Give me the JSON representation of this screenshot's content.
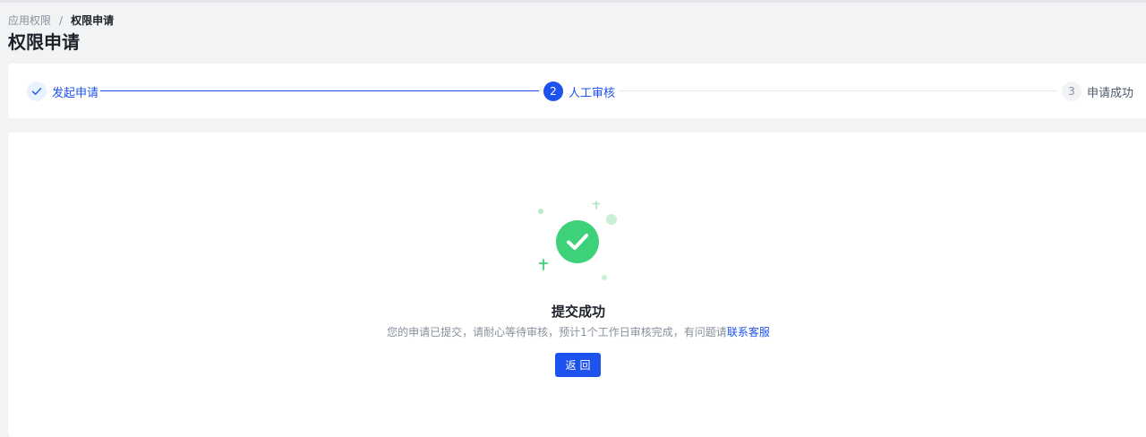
{
  "breadcrumb": {
    "items": [
      "应用权限",
      "权限申请"
    ],
    "separator": "/"
  },
  "page": {
    "title": "权限申请"
  },
  "steps": [
    {
      "number": "1",
      "label": "发起申请",
      "status": "done"
    },
    {
      "number": "2",
      "label": "人工审核",
      "status": "active"
    },
    {
      "number": "3",
      "label": "申请成功",
      "status": "pending"
    }
  ],
  "result": {
    "icon": "check-circle-icon",
    "title": "提交成功",
    "description": "您的申请已提交，请耐心等待审核，预计1个工作日审核完成，有问题请",
    "link_text": "联系客服",
    "back_label": "返回"
  },
  "colors": {
    "primary": "#1d52ef",
    "success": "#3dd27a",
    "success_light": "#b8ecc7",
    "background": "#f2f3f5"
  }
}
